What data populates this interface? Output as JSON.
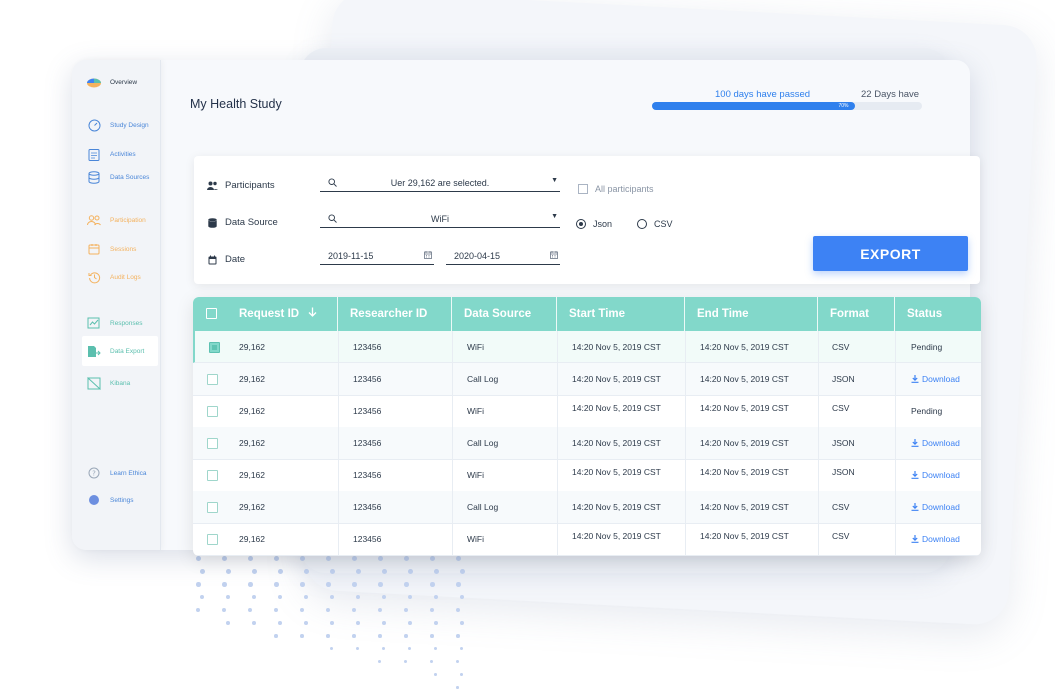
{
  "app": {
    "title": "My Health Study"
  },
  "sidebar": {
    "items": [
      {
        "label": "Overview"
      },
      {
        "label": "Study Design"
      },
      {
        "label": "Activities"
      },
      {
        "label": "Data Sources"
      },
      {
        "label": "Participation"
      },
      {
        "label": "Sessions"
      },
      {
        "label": "Audit Logs"
      },
      {
        "label": "Responses"
      },
      {
        "label": "Data Export"
      },
      {
        "label": "Kibana"
      },
      {
        "label": "Learn Ethica"
      },
      {
        "label": "Settings"
      }
    ],
    "active": "Data Export"
  },
  "progress": {
    "passed_label": "100 days have passed",
    "remaining_label": "22 Days have",
    "percent_label": "70%",
    "fraction": 0.75
  },
  "filters": {
    "participants": {
      "label": "Participants",
      "value": "Uer 29,162 are selected."
    },
    "data_source": {
      "label": "Data Source",
      "value": "WiFi"
    },
    "date": {
      "label": "Date",
      "from": "2019-11-15",
      "to": "2020-04-15"
    },
    "all_participants_label": "All participants",
    "format_options": [
      "Json",
      "CSV"
    ],
    "format_selected": "Json",
    "export_label": "EXPORT"
  },
  "table": {
    "columns": [
      "Request ID",
      "Researcher ID",
      "Data Source",
      "Start Time",
      "End Time",
      "Format",
      "Status"
    ],
    "sort_icon": "arrow-down-icon",
    "rows": [
      {
        "request_id": "29,162",
        "researcher_id": "123456",
        "source": "WiFi",
        "start": "14:20 Nov 5, 2019 CST",
        "end": "14:20 Nov 5, 2019 CST",
        "format": "CSV",
        "status": "Pending",
        "selected": true
      },
      {
        "request_id": "29,162",
        "researcher_id": "123456",
        "source": "Call Log",
        "start": "14:20 Nov 5, 2019 CST",
        "end": "14:20 Nov 5, 2019 CST",
        "format": "JSON",
        "status": "Download",
        "selected": false
      },
      {
        "request_id": "29,162",
        "researcher_id": "123456",
        "source": "WiFi",
        "start": "14:20 Nov 5, 2019 CST",
        "end": "14:20 Nov 5, 2019 CST",
        "format": "CSV",
        "status": "Pending",
        "selected": false
      },
      {
        "request_id": "29,162",
        "researcher_id": "123456",
        "source": "Call Log",
        "start": "14:20 Nov 5, 2019 CST",
        "end": "14:20 Nov 5, 2019 CST",
        "format": "JSON",
        "status": "Download",
        "selected": false
      },
      {
        "request_id": "29,162",
        "researcher_id": "123456",
        "source": "WiFi",
        "start": "14:20 Nov 5, 2019 CST",
        "end": "14:20 Nov 5, 2019 CST",
        "format": "JSON",
        "status": "Download",
        "selected": false
      },
      {
        "request_id": "29,162",
        "researcher_id": "123456",
        "source": "Call Log",
        "start": "14:20 Nov 5, 2019 CST",
        "end": "14:20 Nov 5, 2019 CST",
        "format": "CSV",
        "status": "Download",
        "selected": false
      },
      {
        "request_id": "29,162",
        "researcher_id": "123456",
        "source": "WiFi",
        "start": "14:20 Nov 5, 2019 CST",
        "end": "14:20 Nov 5, 2019 CST",
        "format": "CSV",
        "status": "Download",
        "selected": false
      }
    ]
  },
  "colors": {
    "accent": "#3d82f4",
    "table_header": "#82d8ca",
    "nav_orange": "#f4b25e",
    "nav_green": "#5bbfae"
  }
}
